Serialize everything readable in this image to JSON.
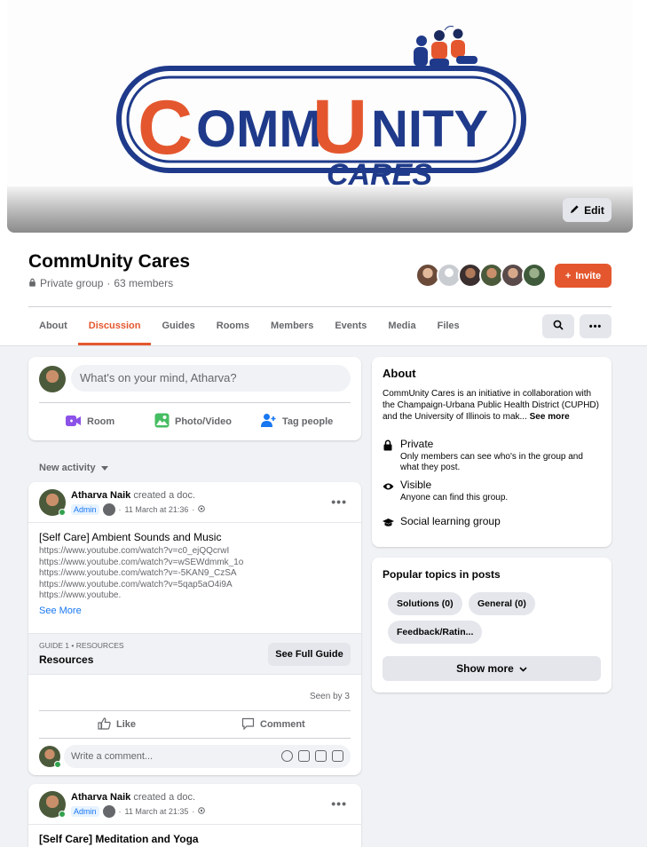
{
  "cover": {
    "logo_word": "CommUnity",
    "logo_sub": "CARES",
    "edit_label": "Edit"
  },
  "group": {
    "name": "CommUnity Cares",
    "privacy": "Private group",
    "members": "63 members",
    "invite_label": "Invite"
  },
  "tabs": [
    "About",
    "Discussion",
    "Guides",
    "Rooms",
    "Members",
    "Events",
    "Media",
    "Files"
  ],
  "composer": {
    "placeholder": "What's on your mind, Atharva?",
    "actions": [
      "Room",
      "Photo/Video",
      "Tag people"
    ]
  },
  "feed": {
    "sort_label": "New activity"
  },
  "posts": [
    {
      "author": "Atharva Naik",
      "action": "created a doc.",
      "badge": "Admin",
      "time": "11 March at 21:36",
      "doc_title": "[Self Care] Ambient Sounds and Music",
      "links": [
        "https://www.youtube.com/watch?v=c0_ejQQcrwI",
        "https://www.youtube.com/watch?v=wSEWdmmk_1o",
        "https://www.youtube.com/watch?v=-5KAN9_CzSA",
        "https://www.youtube.com/watch?v=5qap5aO4i9A",
        "https://www.youtube."
      ],
      "see_more": "See More",
      "guide_kicker": "GUIDE 1 • RESOURCES",
      "guide_name": "Resources",
      "guide_button": "See Full Guide",
      "seen_by": "Seen by 3",
      "like_label": "Like",
      "comment_label": "Comment",
      "comment_placeholder": "Write a comment..."
    },
    {
      "author": "Atharva Naik",
      "action": "created a doc.",
      "badge": "Admin",
      "time": "11 March at 21:35",
      "doc_title": "[Self Care] Meditation and Yoga"
    }
  ],
  "about": {
    "heading": "About",
    "description": "CommUnity Cares is an initiative in collaboration with the Champaign-Urbana Public Health District (CUPHD) and the University of Illinois to mak...",
    "see_more": "See more",
    "private_title": "Private",
    "private_desc": "Only members can see who's in the group and what they post.",
    "visible_title": "Visible",
    "visible_desc": "Anyone can find this group.",
    "type_label": "Social learning group"
  },
  "topics": {
    "heading": "Popular topics in posts",
    "chips": [
      "Solutions (0)",
      "General (0)",
      "Feedback/Ratin..."
    ],
    "show_more": "Show more"
  },
  "colors": {
    "accent": "#e4572e",
    "logo_blue": "#1f3a8a",
    "link_blue": "#1877f2"
  }
}
